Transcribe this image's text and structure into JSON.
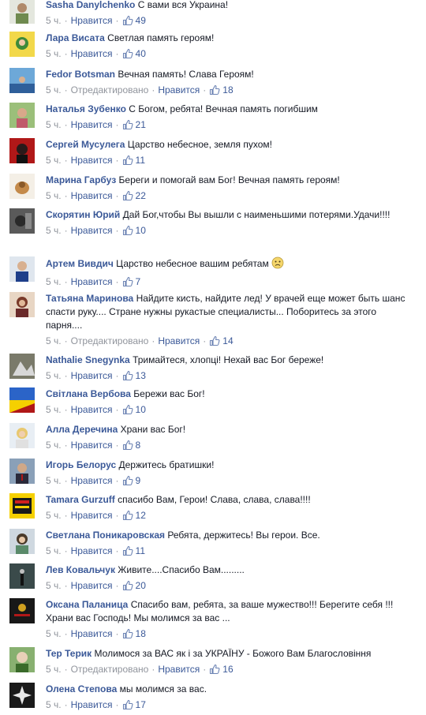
{
  "comments": [
    {
      "author": "Sasha Danylchenko",
      "text": "С вами вся Украина!",
      "time": "5 ч.",
      "edited": "",
      "like_label": "Нравится",
      "likes": "49"
    },
    {
      "author": "Лара Висата",
      "text": "Светлая память героям!",
      "time": "5 ч.",
      "edited": "",
      "like_label": "Нравится",
      "likes": "40"
    },
    {
      "author": "Fedor Botsman",
      "text": "Вечная память! Слава Героям!",
      "time": "5 ч.",
      "edited": "Отредактировано",
      "like_label": "Нравится",
      "likes": "18"
    },
    {
      "author": "Наталья Зубенко",
      "text": "С Богом, ребята! Вечная память погибшим",
      "time": "5 ч.",
      "edited": "",
      "like_label": "Нравится",
      "likes": "21"
    },
    {
      "author": "Сергей Мусулега",
      "text": "Царство небесное, земля пухом!",
      "time": "5 ч.",
      "edited": "",
      "like_label": "Нравится",
      "likes": "11"
    },
    {
      "author": "Марина Гарбуз",
      "text": "Береги и помогай вам Бог! Вечная память героям!",
      "time": "5 ч.",
      "edited": "",
      "like_label": "Нравится",
      "likes": "22"
    },
    {
      "author": "Скорятин Юрий",
      "text": "Дай Бог,чтобы Вы вышли с наименьшими потерями.Удачи!!!!",
      "time": "5 ч.",
      "edited": "",
      "like_label": "Нравится",
      "likes": "10"
    },
    {
      "author": "Артем Вивдич",
      "text": "Царство небесное вашим ребятам",
      "time": "5 ч.",
      "edited": "",
      "like_label": "Нравится",
      "likes": "7"
    },
    {
      "author": "Татьяна Маринова",
      "text": "Найдите кисть, найдите лед! У врачей еще может быть шанс спасти руку.... Стране нужны рукастые специалисты... Поборитесь за этого парня....",
      "time": "5 ч.",
      "edited": "Отредактировано",
      "like_label": "Нравится",
      "likes": "14"
    },
    {
      "author": "Nathalie Snegynka",
      "text": "Тримайтеся, хлопці! Нехай вас Бог береже!",
      "time": "5 ч.",
      "edited": "",
      "like_label": "Нравится",
      "likes": "13"
    },
    {
      "author": "Світлана Вербова",
      "text": "Бережи вас Бог!",
      "time": "5 ч.",
      "edited": "",
      "like_label": "Нравится",
      "likes": "10"
    },
    {
      "author": "Алла Деречина",
      "text": "Храни вас Бог!",
      "time": "5 ч.",
      "edited": "",
      "like_label": "Нравится",
      "likes": "8"
    },
    {
      "author": "Игорь Белорус",
      "text": "Держитесь братишки!",
      "time": "5 ч.",
      "edited": "",
      "like_label": "Нравится",
      "likes": "9"
    },
    {
      "author": "Tamara Gurzuff",
      "text": "спасибо Вам, Герои! Слава, слава, слава!!!!",
      "time": "5 ч.",
      "edited": "",
      "like_label": "Нравится",
      "likes": "12"
    },
    {
      "author": "Светлана Поникаровская",
      "text": "Ребята, держитесь! Вы герои. Все.",
      "time": "5 ч.",
      "edited": "",
      "like_label": "Нравится",
      "likes": "11"
    },
    {
      "author": "Лев Ковальчук",
      "text": "Живите....Спасибо Вам.........",
      "time": "5 ч.",
      "edited": "",
      "like_label": "Нравится",
      "likes": "20"
    },
    {
      "author": "Оксана Паланица",
      "text": "Спасибо вам, ребята, за ваше мужество!!! Берегите себя !!! Храни вас Господь! Мы молимся за вас ...",
      "time": "5 ч.",
      "edited": "",
      "like_label": "Нравится",
      "likes": "18"
    },
    {
      "author": "Тер Терик",
      "text": "Молимося за ВАС як і за УКРАЇНУ - Божого Вам Благословіння",
      "time": "5 ч.",
      "edited": "Отредактировано",
      "like_label": "Нравится",
      "likes": "16"
    },
    {
      "author": "Олена Степова",
      "text": "мы молимся за вас.",
      "time": "5 ч.",
      "edited": "",
      "like_label": "Нравится",
      "likes": "17"
    }
  ],
  "colors": {
    "link": "#3b5998",
    "meta": "#90949c",
    "text": "#141823"
  }
}
